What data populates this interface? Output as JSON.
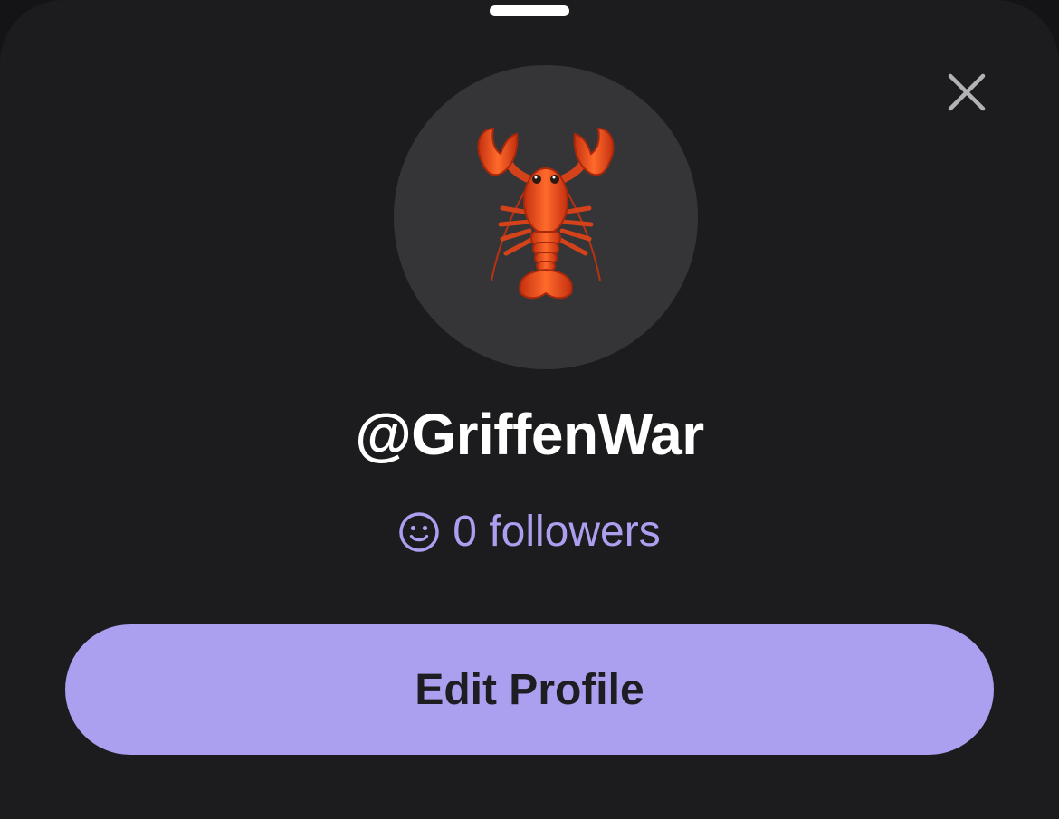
{
  "sheet": {
    "grabber": "drag-handle",
    "close_icon": "close-icon"
  },
  "profile": {
    "avatar_icon": "lobster-icon",
    "username": "@GriffenWar",
    "followers_icon": "smiley-icon",
    "followers_text": "0 followers"
  },
  "actions": {
    "edit_profile_label": "Edit Profile"
  },
  "colors": {
    "background": "#1c1c1e",
    "avatar_bg": "#353537",
    "accent": "#ab9ff0",
    "accent_text": "#ad9ff0",
    "button_text": "#1e1e22"
  }
}
